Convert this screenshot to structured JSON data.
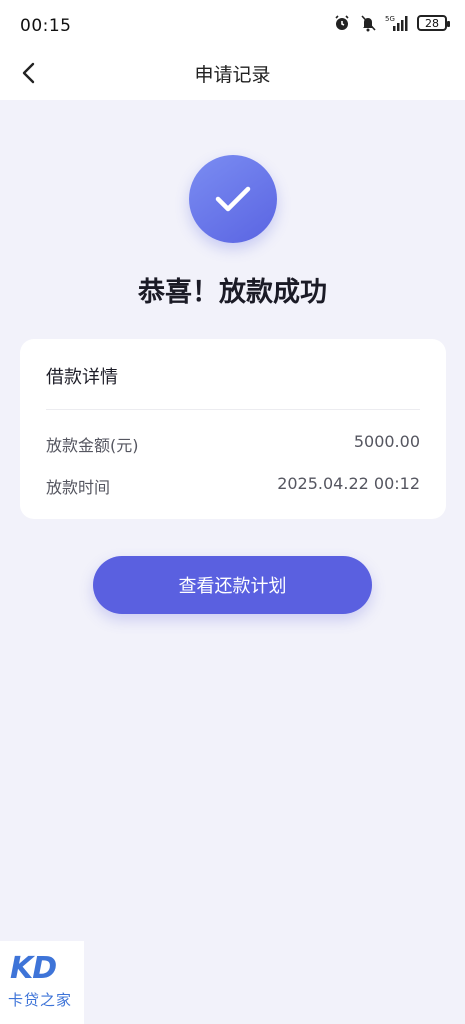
{
  "status_bar": {
    "time": "00:15",
    "network": "5G",
    "battery": "28",
    "icons": [
      "alarm-icon",
      "mute-icon",
      "signal-icon",
      "battery-icon"
    ]
  },
  "header": {
    "title": "申请记录",
    "back_icon": "chevron-left-icon"
  },
  "result": {
    "icon": "check-icon",
    "title": "恭喜！放款成功"
  },
  "details": {
    "title": "借款详情",
    "rows": [
      {
        "label": "放款金额(元)",
        "value": "5000.00"
      },
      {
        "label": "放款时间",
        "value": "2025.04.22 00:12"
      }
    ]
  },
  "actions": {
    "view_plan_label": "查看还款计划"
  },
  "watermark": {
    "logo": "KD",
    "text": "卡贷之家"
  },
  "colors": {
    "accent": "#5a60e0",
    "background": "#f2f2fa",
    "watermark": "#3e74d8"
  }
}
